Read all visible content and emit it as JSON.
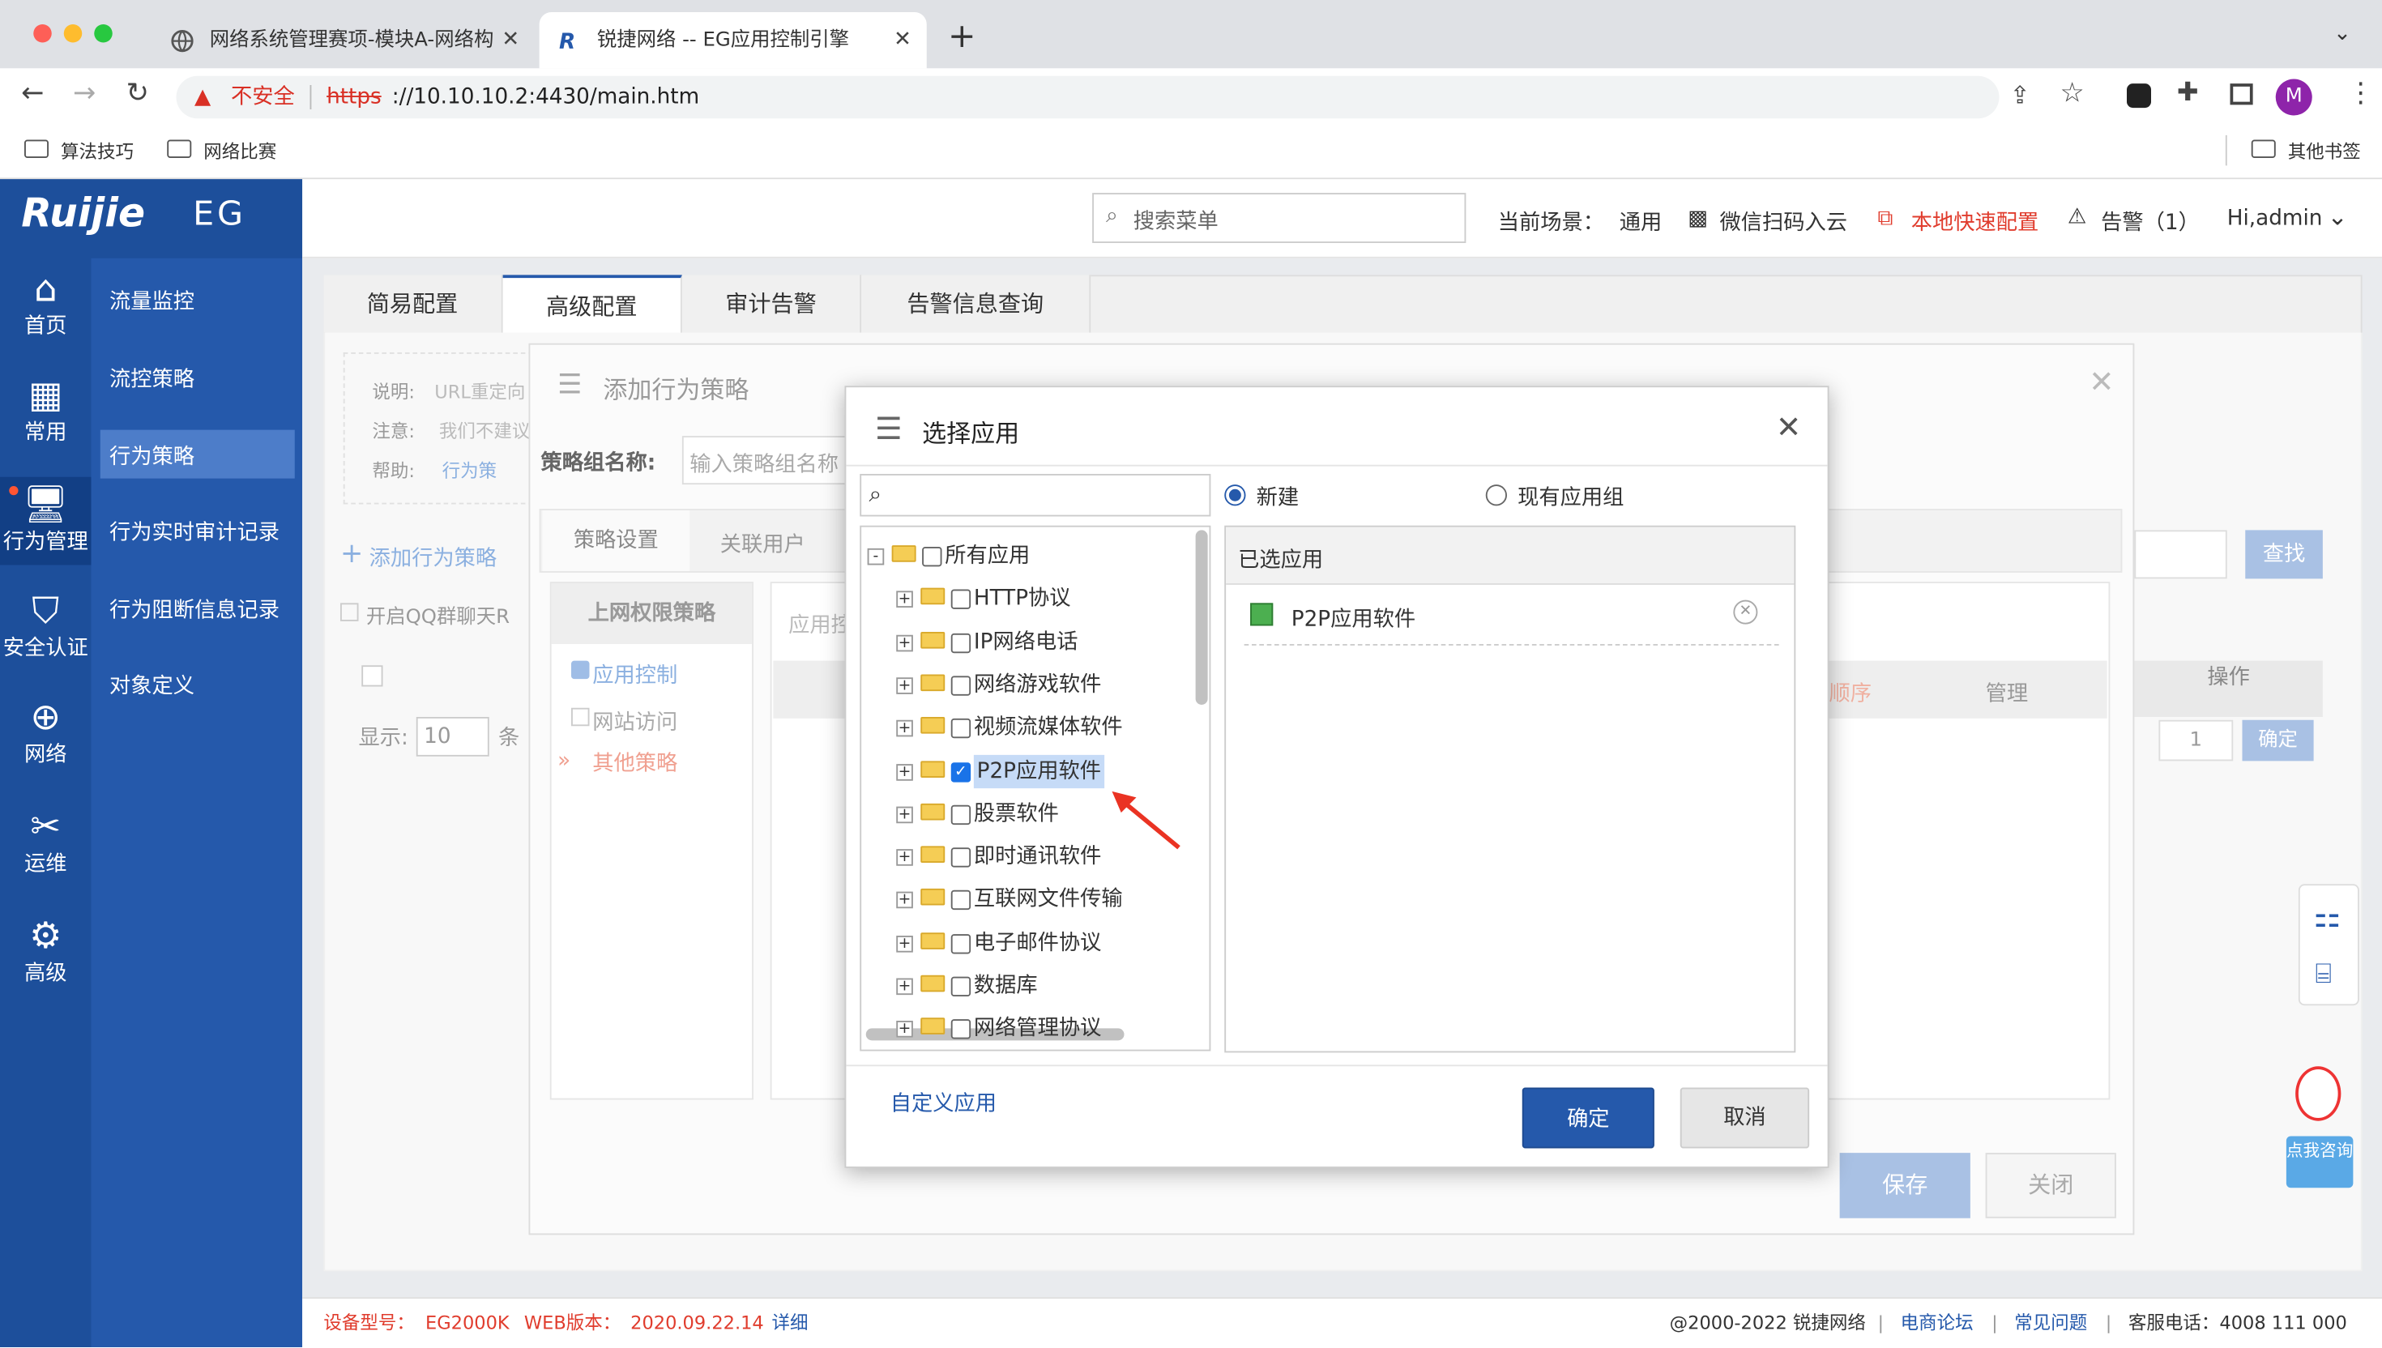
{
  "browser": {
    "tabs": [
      {
        "title": "网络系统管理赛项-模块A-网络构"
      },
      {
        "title": "锐捷网络 -- EG应用控制引擎"
      }
    ],
    "insecure": "不安全",
    "url_scheme": "https",
    "url_rest": "://10.10.10.2:4430/main.htm",
    "bookmarks": [
      "算法技巧",
      "网络比赛"
    ],
    "other_bookmarks": "其他书签",
    "profile": "M"
  },
  "app": {
    "brand": "Ruijie",
    "product": "EG",
    "search_placeholder": "搜索菜单",
    "scene_label": "当前场景：",
    "scene_value": "通用",
    "wechat": "微信扫码入云",
    "quick_config": "本地快速配置",
    "alert": "告警（1）",
    "user": "Hi,admin",
    "accent": "#2559ab",
    "danger": "#e03c2d"
  },
  "nav1": [
    {
      "icon": "home-icon",
      "label": "首页"
    },
    {
      "icon": "grid-icon",
      "label": "常用"
    },
    {
      "icon": "monitor-icon",
      "label": "行为管理"
    },
    {
      "icon": "shield-icon",
      "label": "安全认证"
    },
    {
      "icon": "globe-icon",
      "label": "网络"
    },
    {
      "icon": "tools-icon",
      "label": "运维"
    },
    {
      "icon": "gear-icon",
      "label": "高级"
    }
  ],
  "nav2": [
    "流量监控",
    "流控策略",
    "行为策略",
    "行为实时审计记录",
    "行为阻断信息记录",
    "对象定义"
  ],
  "main_tabs": [
    "简易配置",
    "高级配置",
    "审计告警",
    "告警信息查询"
  ],
  "bg": {
    "desc_label": "说明:",
    "desc_text": "URL重定向",
    "note_label": "注意:",
    "note_text": "我们不建议",
    "help_label": "帮助:",
    "help_text": "行为策",
    "add_policy": "添加行为策略",
    "qq_option": "开启QQ群聊天R",
    "show_label": "显示:",
    "show_value": "10",
    "show_unit": "条",
    "search_btn": "查找",
    "order_col": "顺序",
    "manage_col": "管理",
    "op_col": "操作",
    "page_input": "1",
    "confirm": "确定"
  },
  "dialog_add": {
    "title": "添加行为策略",
    "group_label": "策略组名称:",
    "group_placeholder": "输入策略组名称",
    "tabs": [
      "策略设置",
      "关联用户"
    ],
    "left_title": "上网权限策略",
    "items": [
      "应用控制",
      "网站访问",
      "其他策略"
    ],
    "app_col": "应用控",
    "save": "保存",
    "close": "关闭"
  },
  "dialog_app": {
    "title": "选择应用",
    "radio_new": "新建",
    "radio_existing": "现有应用组",
    "selected_title": "已选应用",
    "selected_items": [
      "P2P应用软件"
    ],
    "custom_link": "自定义应用",
    "ok": "确定",
    "cancel": "取消",
    "tree": [
      {
        "label": "所有应用",
        "checked": false
      },
      {
        "label": "HTTP协议",
        "checked": false
      },
      {
        "label": "IP网络电话",
        "checked": false
      },
      {
        "label": "网络游戏软件",
        "checked": false
      },
      {
        "label": "视频流媒体软件",
        "checked": false
      },
      {
        "label": "P2P应用软件",
        "checked": true
      },
      {
        "label": "股票软件",
        "checked": false
      },
      {
        "label": "即时通讯软件",
        "checked": false
      },
      {
        "label": "互联网文件传输",
        "checked": false
      },
      {
        "label": "电子邮件协议",
        "checked": false
      },
      {
        "label": "数据库",
        "checked": false
      },
      {
        "label": "网络管理协议",
        "checked": false
      }
    ]
  },
  "chat": {
    "label": "点我咨询"
  },
  "footer": {
    "model_label": "设备型号：",
    "model": "EG2000K",
    "web_label": "WEB版本：",
    "web": "2020.09.22.14",
    "detail": "详细",
    "copyright": "@2000-2022 锐捷网络",
    "forum": "电商论坛",
    "faq": "常见问题",
    "phone": "客服电话：4008 111 000"
  }
}
